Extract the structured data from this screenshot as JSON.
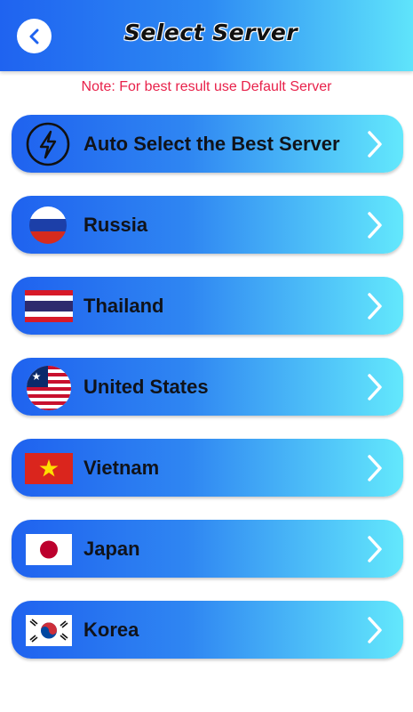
{
  "header": {
    "title": "Select Server",
    "back_icon": "chevron-left-icon",
    "gradient": [
      "#1f63f0",
      "#5fe4fb"
    ]
  },
  "note": "Note: For best result use Default Server",
  "servers": [
    {
      "label": "Auto Select the Best Server",
      "icon": "lightning-bolt-icon"
    },
    {
      "label": "Russia",
      "icon": "russia-flag-icon"
    },
    {
      "label": "Thailand",
      "icon": "thailand-flag-icon"
    },
    {
      "label": "United States",
      "icon": "us-flag-icon"
    },
    {
      "label": "Vietnam",
      "icon": "vietnam-flag-icon"
    },
    {
      "label": "Japan",
      "icon": "japan-flag-icon"
    },
    {
      "label": "Korea",
      "icon": "korea-flag-icon"
    }
  ],
  "colors": {
    "note_text": "#e8214a",
    "item_gradient_start": "#1f62ef",
    "item_gradient_end": "#63e8fc"
  }
}
